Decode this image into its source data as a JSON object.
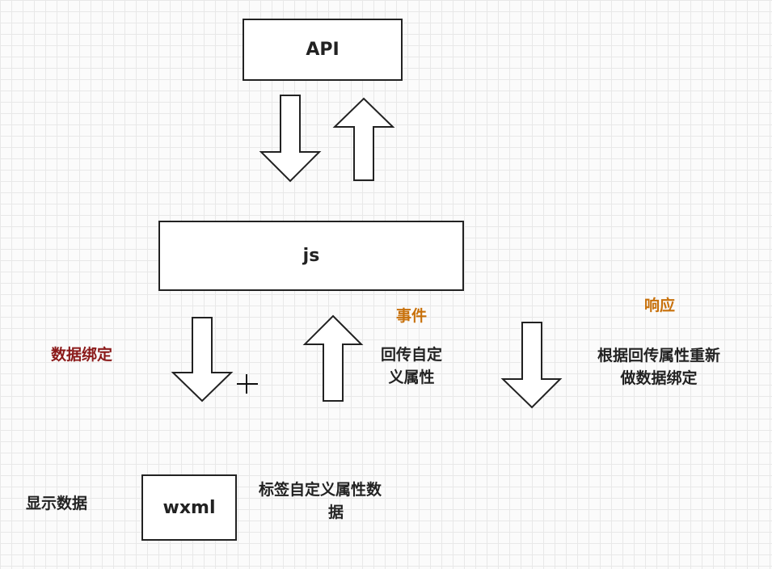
{
  "boxes": {
    "api": "API",
    "js": "js",
    "wxml": "wxml"
  },
  "labels": {
    "data_binding": "数据绑定",
    "event": "事件",
    "callback_custom_attr_line1": "回传自定",
    "callback_custom_attr_line2": "义属性",
    "response": "响应",
    "rebind_line1": "根据回传属性重新",
    "rebind_line2": "做数据绑定",
    "show_data": "显示数据",
    "tag_attr_data_line1": "标签自定义属性数",
    "tag_attr_data_line2": "据"
  },
  "colors": {
    "box_border": "#222222",
    "data_binding_label": "#8b1a1a",
    "event_label": "#c8710b",
    "grid": "#e8e8e8"
  }
}
